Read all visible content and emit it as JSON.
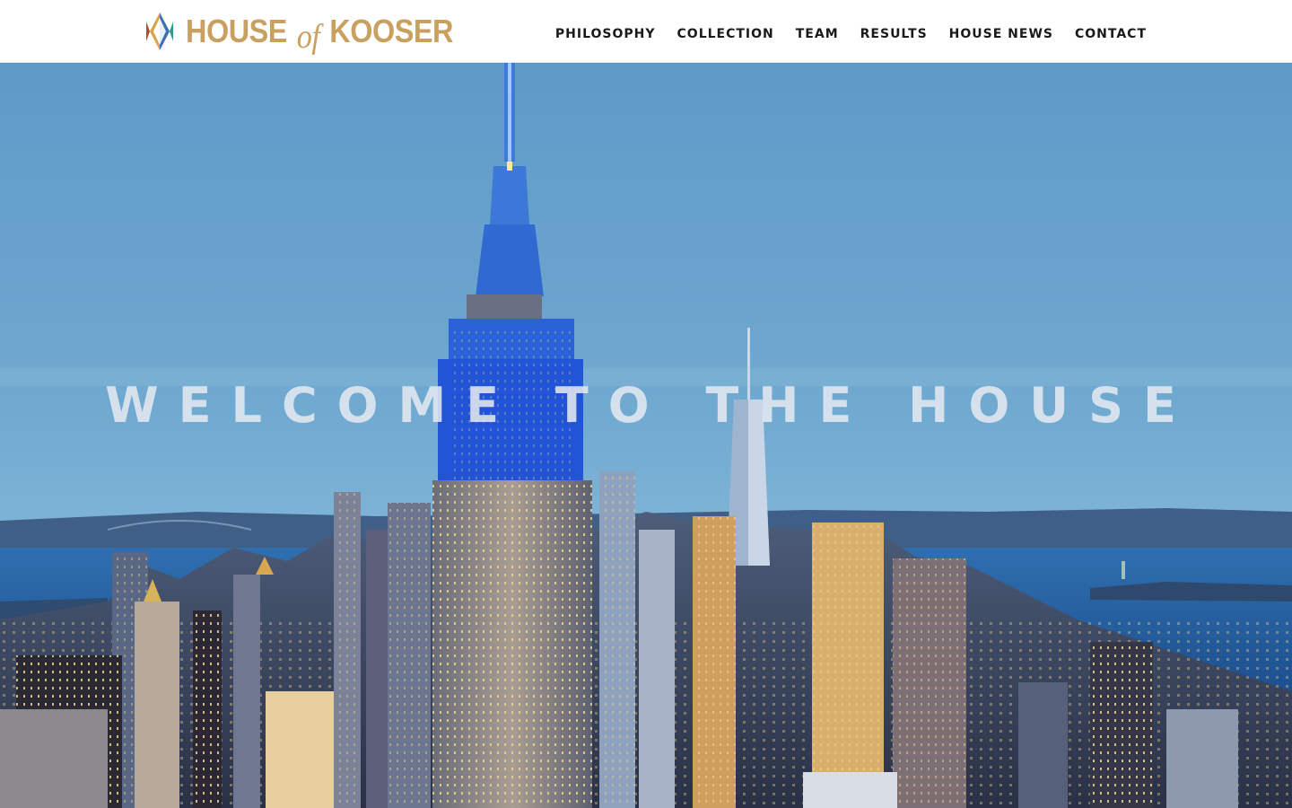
{
  "brand": {
    "logo_icon": "diamond-logo-icon",
    "name_part1": "HOUSE",
    "name_part2": "of",
    "name_part3": "KOOSER",
    "color": "#c8a060"
  },
  "nav": {
    "items": [
      {
        "label": "PHILOSOPHY"
      },
      {
        "label": "COLLECTION"
      },
      {
        "label": "TEAM"
      },
      {
        "label": "RESULTS"
      },
      {
        "label": "HOUSE NEWS"
      },
      {
        "label": "CONTACT"
      }
    ]
  },
  "hero": {
    "title": "WELCOME TO THE HOUSE",
    "image": "new-york-skyline-photo"
  }
}
